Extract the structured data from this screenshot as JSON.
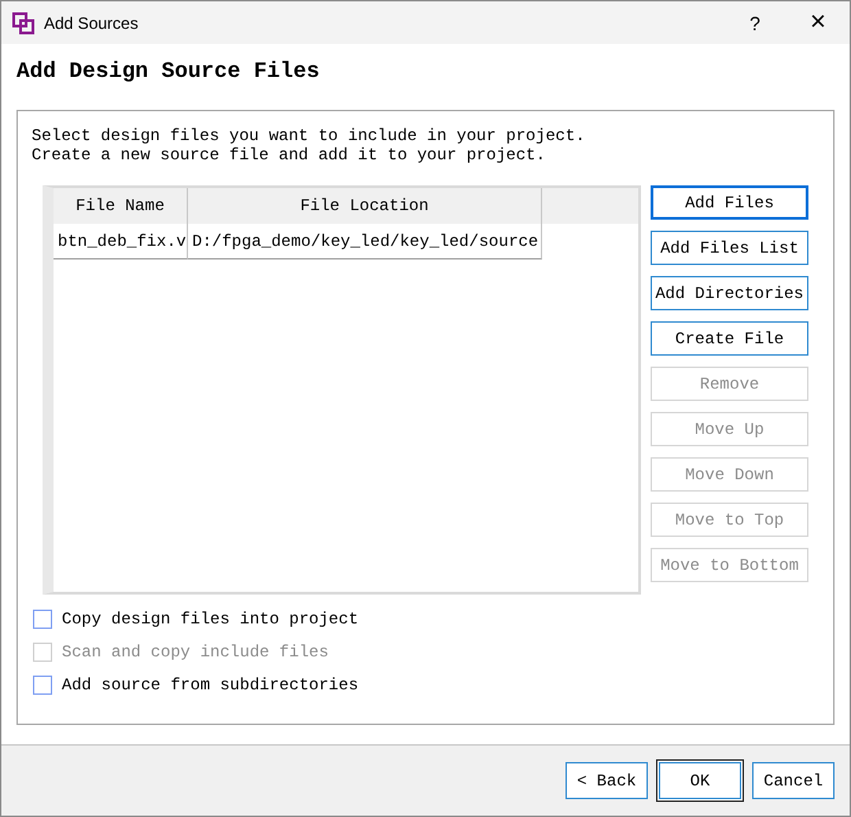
{
  "window": {
    "title": "Add Sources",
    "help": "?",
    "close": "×"
  },
  "heading": "Add Design Source Files",
  "description": [
    "Select design files you want to include in your project.",
    "Create a new source file and add it to your project."
  ],
  "table": {
    "columns": [
      "File Name",
      "File Location"
    ],
    "rows": [
      {
        "cells": [
          "btn_deb_fix.v",
          "D:/fpga_demo/key_led/key_led/source"
        ],
        "selected": false
      }
    ]
  },
  "side_buttons": [
    {
      "label": "Add Files",
      "disabled": false,
      "default": true
    },
    {
      "label": "Add Files List",
      "disabled": false,
      "default": false
    },
    {
      "label": "Add Directories",
      "disabled": false,
      "default": false
    },
    {
      "label": "Create File",
      "disabled": false,
      "default": false
    },
    {
      "label": "Remove",
      "disabled": true,
      "default": false
    },
    {
      "label": "Move Up",
      "disabled": true,
      "default": false
    },
    {
      "label": "Move Down",
      "disabled": true,
      "default": false
    },
    {
      "label": "Move to Top",
      "disabled": true,
      "default": false
    },
    {
      "label": "Move to Bottom",
      "disabled": true,
      "default": false
    }
  ],
  "options": [
    {
      "label": "Copy design files into project",
      "checked": false,
      "disabled": false
    },
    {
      "label": "Scan and copy include files",
      "checked": false,
      "disabled": true
    },
    {
      "label": "Add source from subdirectories",
      "checked": false,
      "disabled": false
    }
  ],
  "footer_buttons": [
    {
      "label": "< Back",
      "focused": false
    },
    {
      "label": "OK",
      "focused": true
    },
    {
      "label": "Cancel",
      "focused": false
    }
  ]
}
